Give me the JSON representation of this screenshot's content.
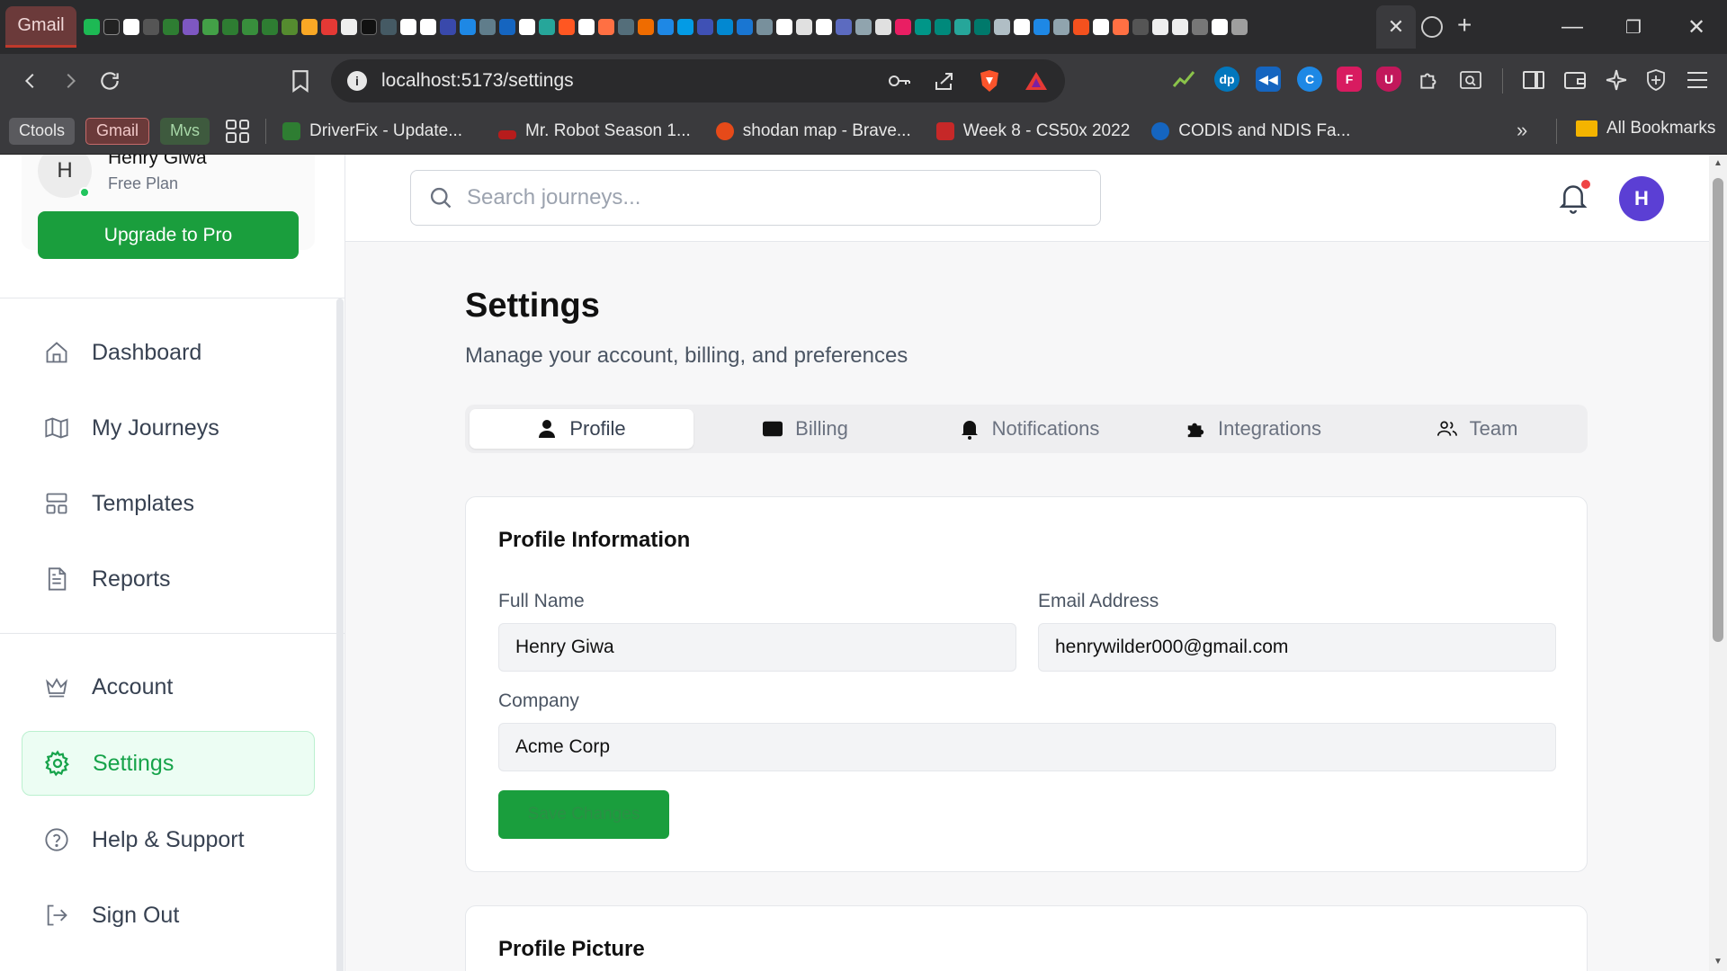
{
  "browser": {
    "gmail_tab_label": "Gmail",
    "url": "localhost:5173/settings",
    "bookmarks": {
      "chips": [
        {
          "label": "Ctools",
          "bg": "#5a5a5e",
          "fg": "#e8e8e8"
        },
        {
          "label": "Gmail",
          "bg": "#6b3a3a",
          "fg": "#f0c8c8"
        },
        {
          "label": "Mvs",
          "bg": "#3e5a3e",
          "fg": "#a8d8a8"
        }
      ],
      "items": [
        {
          "label": "DriverFix - Update...",
          "color": "#2e7d32"
        },
        {
          "label": "Mr. Robot Season 1...",
          "color": "#b71c1c"
        },
        {
          "label": "shodan map - Brave...",
          "color": "#e64a19"
        },
        {
          "label": "Week 8 - CS50x 2022",
          "color": "#c62828"
        },
        {
          "label": "CODIS and NDIS Fa...",
          "color": "#1565c0"
        }
      ],
      "all_bookmarks": "All Bookmarks"
    }
  },
  "sidebar": {
    "avatar_initial": "H",
    "user_name": "Henry Giwa",
    "user_plan": "Free Plan",
    "upgrade_label": "Upgrade to Pro",
    "nav": [
      {
        "label": "Dashboard"
      },
      {
        "label": "My Journeys"
      },
      {
        "label": "Templates"
      },
      {
        "label": "Reports"
      },
      {
        "label": "Account"
      },
      {
        "label": "Settings"
      },
      {
        "label": "Help & Support"
      },
      {
        "label": "Sign Out"
      }
    ],
    "active_item": "Settings"
  },
  "topbar": {
    "search_placeholder": "Search journeys...",
    "avatar_initial": "H",
    "avatar_color": "#5b3fd4",
    "notification_dot_color": "#ef4444"
  },
  "page": {
    "title": "Settings",
    "subtitle": "Manage your account, billing, and preferences",
    "tabs": [
      {
        "label": "Profile",
        "icon": "user-icon"
      },
      {
        "label": "Billing",
        "icon": "credit-card-icon"
      },
      {
        "label": "Notifications",
        "icon": "bell-icon"
      },
      {
        "label": "Integrations",
        "icon": "puzzle-icon"
      },
      {
        "label": "Team",
        "icon": "users-icon"
      }
    ],
    "active_tab": "Profile"
  },
  "profile_info": {
    "title": "Profile Information",
    "full_name_label": "Full Name",
    "full_name_value": "Henry Giwa",
    "email_label": "Email Address",
    "email_value": "henrywilder000@gmail.com",
    "company_label": "Company",
    "company_value": "Acme Corp",
    "save_label": "Save Changes"
  },
  "profile_picture": {
    "title": "Profile Picture"
  },
  "colors": {
    "accent_green": "#1a9e3d",
    "active_nav_bg": "#ecfdf3"
  }
}
